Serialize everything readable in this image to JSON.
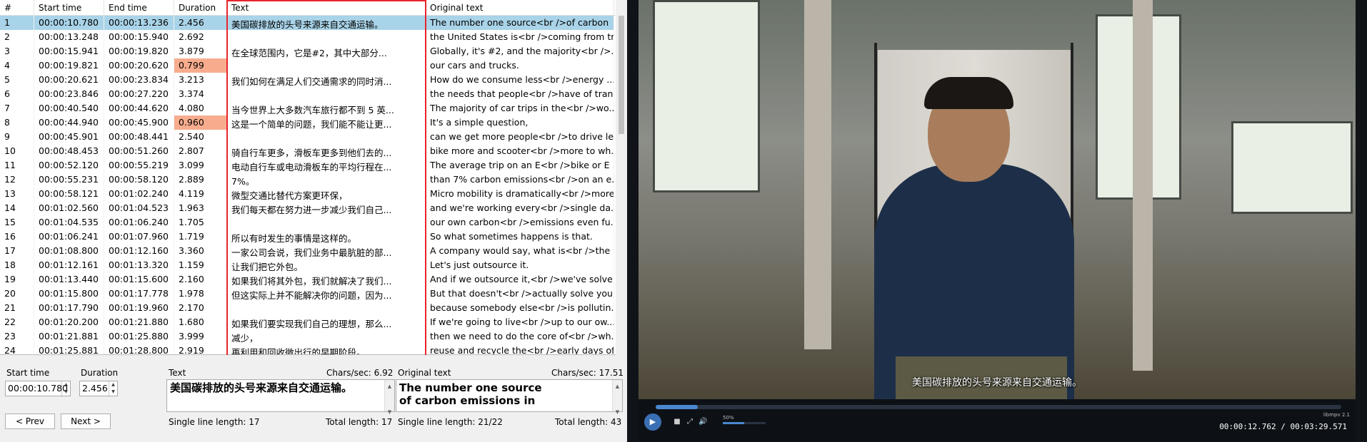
{
  "grid": {
    "headers": [
      "#",
      "Start time",
      "End time",
      "Duration",
      "Text",
      "Original text"
    ],
    "rows": [
      {
        "n": "1",
        "start": "00:00:10.780",
        "end": "00:00:13.236",
        "dur": "2.456",
        "text": "美国碳排放的头号来源来自交通运输。",
        "orig": "The number one source<br />of carbon"
      },
      {
        "n": "2",
        "start": "00:00:13.248",
        "end": "00:00:15.940",
        "dur": "2.692",
        "text": "",
        "orig": "the United States is<br />coming from tr..."
      },
      {
        "n": "3",
        "start": "00:00:15.941",
        "end": "00:00:19.820",
        "dur": "3.879",
        "text": "在全球范围内，它是#2，其中大部分...",
        "orig": "Globally, it's #2, and the majority<br />..."
      },
      {
        "n": "4",
        "start": "00:00:19.821",
        "end": "00:00:20.620",
        "dur": "0.799",
        "text": "",
        "orig": "our cars and trucks."
      },
      {
        "n": "5",
        "start": "00:00:20.621",
        "end": "00:00:23.834",
        "dur": "3.213",
        "text": "我们如何在满足人们交通需求的同时消...",
        "orig": "How do we consume less<br />energy ..."
      },
      {
        "n": "6",
        "start": "00:00:23.846",
        "end": "00:00:27.220",
        "dur": "3.374",
        "text": "",
        "orig": "the needs that people<br />have of tran..."
      },
      {
        "n": "7",
        "start": "00:00:40.540",
        "end": "00:00:44.620",
        "dur": "4.080",
        "text": "当今世界上大多数汽车旅行都不到 5 英...",
        "orig": "The majority of car trips in the<br />wo..."
      },
      {
        "n": "8",
        "start": "00:00:44.940",
        "end": "00:00:45.900",
        "dur": "0.960",
        "text": "这是一个简单的问题，我们能不能让更...",
        "orig": "It's a simple question,"
      },
      {
        "n": "9",
        "start": "00:00:45.901",
        "end": "00:00:48.441",
        "dur": "2.540",
        "text": "",
        "orig": "can we get more people<br />to drive le..."
      },
      {
        "n": "10",
        "start": "00:00:48.453",
        "end": "00:00:51.260",
        "dur": "2.807",
        "text": "骑自行车更多，滑板车更多到他们去的...",
        "orig": "bike more and scooter<br />more to wh..."
      },
      {
        "n": "11",
        "start": "00:00:52.120",
        "end": "00:00:55.219",
        "dur": "3.099",
        "text": "电动自行车或电动滑板车的平均行程在...",
        "orig": "The average trip on an E<br />bike or E ..."
      },
      {
        "n": "12",
        "start": "00:00:55.231",
        "end": "00:00:58.120",
        "dur": "2.889",
        "text": "7%。",
        "orig": "than 7% carbon emissions<br />on an e..."
      },
      {
        "n": "13",
        "start": "00:00:58.121",
        "end": "00:01:02.240",
        "dur": "4.119",
        "text": "微型交通比替代方案更环保，",
        "orig": "Micro mobility is dramatically<br />more..."
      },
      {
        "n": "14",
        "start": "00:01:02.560",
        "end": "00:01:04.523",
        "dur": "1.963",
        "text": "我们每天都在努力进一步减少我们自己...",
        "orig": "and we're working every<br />single da..."
      },
      {
        "n": "15",
        "start": "00:01:04.535",
        "end": "00:01:06.240",
        "dur": "1.705",
        "text": "",
        "orig": "our own carbon<br />emissions even fu..."
      },
      {
        "n": "16",
        "start": "00:01:06.241",
        "end": "00:01:07.960",
        "dur": "1.719",
        "text": "所以有时发生的事情是这样的。",
        "orig": "So what sometimes happens is that."
      },
      {
        "n": "17",
        "start": "00:01:08.800",
        "end": "00:01:12.160",
        "dur": "3.360",
        "text": "一家公司会说，我们业务中最肮脏的部...",
        "orig": "A company would say, what is<br />the ..."
      },
      {
        "n": "18",
        "start": "00:01:12.161",
        "end": "00:01:13.320",
        "dur": "1.159",
        "text": "让我们把它外包。",
        "orig": "Let's just outsource it."
      },
      {
        "n": "19",
        "start": "00:01:13.440",
        "end": "00:01:15.600",
        "dur": "2.160",
        "text": "如果我们将其外包，我们就解决了我们...",
        "orig": "And if we outsource it,<br />we've solve..."
      },
      {
        "n": "20",
        "start": "00:01:15.800",
        "end": "00:01:17.778",
        "dur": "1.978",
        "text": "但这实际上并不能解决你的问题，因为...",
        "orig": "But that doesn't<br />actually solve your..."
      },
      {
        "n": "21",
        "start": "00:01:17.790",
        "end": "00:01:19.960",
        "dur": "2.170",
        "text": "",
        "orig": "because somebody else<br />is pollutin..."
      },
      {
        "n": "22",
        "start": "00:01:20.200",
        "end": "00:01:21.880",
        "dur": "1.680",
        "text": "如果我们要实现我们自己的理想，那么...",
        "orig": "If we're going to live<br />up to our ow..."
      },
      {
        "n": "23",
        "start": "00:01:21.881",
        "end": "00:01:25.880",
        "dur": "3.999",
        "text": "减少，",
        "orig": "then we need to do the core of<br />wh..."
      },
      {
        "n": "24",
        "start": "00:01:25.881",
        "end": "00:01:28.800",
        "dur": "2.919",
        "text": "再利用和回收微出行的早期阶段。",
        "orig": "reuse and recycle the<br />early days of..."
      }
    ]
  },
  "editor": {
    "start_label": "Start time",
    "duration_label": "Duration",
    "start_value": "00:00:10.780",
    "duration_value": "2.456",
    "text_label": "Text",
    "text_cps": "Chars/sec: 6.92",
    "text_value": "美国碳排放的头号来源来自交通运输。",
    "text_single": "Single line length: 17",
    "text_total": "Total length: 17",
    "orig_label": "Original text",
    "orig_cps": "Chars/sec: 17.51",
    "orig_line1": "The number one source",
    "orig_line2": "of carbon emissions in",
    "orig_single": "Single line length:  21/22",
    "orig_total": "Total length: 43",
    "prev_label": "< Prev",
    "next_label": "Next >"
  },
  "video": {
    "subtitle": "美国碳排放的头号来源来自交通运输。",
    "timecode": "00:00:12.762 / 00:03:29.571",
    "volume_label": "50%",
    "engine_label": "libmpv 2.1",
    "progress": 0.061,
    "volume": 0.5
  }
}
